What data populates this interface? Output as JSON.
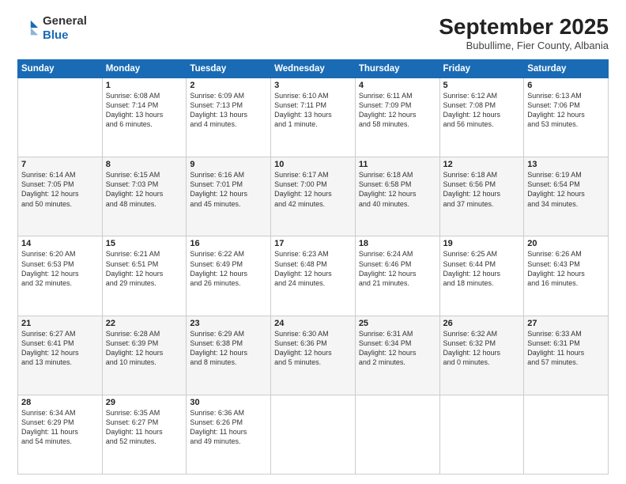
{
  "header": {
    "logo": {
      "line1": "General",
      "line2": "Blue"
    },
    "title": "September 2025",
    "location": "Bubullime, Fier County, Albania"
  },
  "weekdays": [
    "Sunday",
    "Monday",
    "Tuesday",
    "Wednesday",
    "Thursday",
    "Friday",
    "Saturday"
  ],
  "weeks": [
    [
      {
        "day": "",
        "info": ""
      },
      {
        "day": "1",
        "info": "Sunrise: 6:08 AM\nSunset: 7:14 PM\nDaylight: 13 hours\nand 6 minutes."
      },
      {
        "day": "2",
        "info": "Sunrise: 6:09 AM\nSunset: 7:13 PM\nDaylight: 13 hours\nand 4 minutes."
      },
      {
        "day": "3",
        "info": "Sunrise: 6:10 AM\nSunset: 7:11 PM\nDaylight: 13 hours\nand 1 minute."
      },
      {
        "day": "4",
        "info": "Sunrise: 6:11 AM\nSunset: 7:09 PM\nDaylight: 12 hours\nand 58 minutes."
      },
      {
        "day": "5",
        "info": "Sunrise: 6:12 AM\nSunset: 7:08 PM\nDaylight: 12 hours\nand 56 minutes."
      },
      {
        "day": "6",
        "info": "Sunrise: 6:13 AM\nSunset: 7:06 PM\nDaylight: 12 hours\nand 53 minutes."
      }
    ],
    [
      {
        "day": "7",
        "info": "Sunrise: 6:14 AM\nSunset: 7:05 PM\nDaylight: 12 hours\nand 50 minutes."
      },
      {
        "day": "8",
        "info": "Sunrise: 6:15 AM\nSunset: 7:03 PM\nDaylight: 12 hours\nand 48 minutes."
      },
      {
        "day": "9",
        "info": "Sunrise: 6:16 AM\nSunset: 7:01 PM\nDaylight: 12 hours\nand 45 minutes."
      },
      {
        "day": "10",
        "info": "Sunrise: 6:17 AM\nSunset: 7:00 PM\nDaylight: 12 hours\nand 42 minutes."
      },
      {
        "day": "11",
        "info": "Sunrise: 6:18 AM\nSunset: 6:58 PM\nDaylight: 12 hours\nand 40 minutes."
      },
      {
        "day": "12",
        "info": "Sunrise: 6:18 AM\nSunset: 6:56 PM\nDaylight: 12 hours\nand 37 minutes."
      },
      {
        "day": "13",
        "info": "Sunrise: 6:19 AM\nSunset: 6:54 PM\nDaylight: 12 hours\nand 34 minutes."
      }
    ],
    [
      {
        "day": "14",
        "info": "Sunrise: 6:20 AM\nSunset: 6:53 PM\nDaylight: 12 hours\nand 32 minutes."
      },
      {
        "day": "15",
        "info": "Sunrise: 6:21 AM\nSunset: 6:51 PM\nDaylight: 12 hours\nand 29 minutes."
      },
      {
        "day": "16",
        "info": "Sunrise: 6:22 AM\nSunset: 6:49 PM\nDaylight: 12 hours\nand 26 minutes."
      },
      {
        "day": "17",
        "info": "Sunrise: 6:23 AM\nSunset: 6:48 PM\nDaylight: 12 hours\nand 24 minutes."
      },
      {
        "day": "18",
        "info": "Sunrise: 6:24 AM\nSunset: 6:46 PM\nDaylight: 12 hours\nand 21 minutes."
      },
      {
        "day": "19",
        "info": "Sunrise: 6:25 AM\nSunset: 6:44 PM\nDaylight: 12 hours\nand 18 minutes."
      },
      {
        "day": "20",
        "info": "Sunrise: 6:26 AM\nSunset: 6:43 PM\nDaylight: 12 hours\nand 16 minutes."
      }
    ],
    [
      {
        "day": "21",
        "info": "Sunrise: 6:27 AM\nSunset: 6:41 PM\nDaylight: 12 hours\nand 13 minutes."
      },
      {
        "day": "22",
        "info": "Sunrise: 6:28 AM\nSunset: 6:39 PM\nDaylight: 12 hours\nand 10 minutes."
      },
      {
        "day": "23",
        "info": "Sunrise: 6:29 AM\nSunset: 6:38 PM\nDaylight: 12 hours\nand 8 minutes."
      },
      {
        "day": "24",
        "info": "Sunrise: 6:30 AM\nSunset: 6:36 PM\nDaylight: 12 hours\nand 5 minutes."
      },
      {
        "day": "25",
        "info": "Sunrise: 6:31 AM\nSunset: 6:34 PM\nDaylight: 12 hours\nand 2 minutes."
      },
      {
        "day": "26",
        "info": "Sunrise: 6:32 AM\nSunset: 6:32 PM\nDaylight: 12 hours\nand 0 minutes."
      },
      {
        "day": "27",
        "info": "Sunrise: 6:33 AM\nSunset: 6:31 PM\nDaylight: 11 hours\nand 57 minutes."
      }
    ],
    [
      {
        "day": "28",
        "info": "Sunrise: 6:34 AM\nSunset: 6:29 PM\nDaylight: 11 hours\nand 54 minutes."
      },
      {
        "day": "29",
        "info": "Sunrise: 6:35 AM\nSunset: 6:27 PM\nDaylight: 11 hours\nand 52 minutes."
      },
      {
        "day": "30",
        "info": "Sunrise: 6:36 AM\nSunset: 6:26 PM\nDaylight: 11 hours\nand 49 minutes."
      },
      {
        "day": "",
        "info": ""
      },
      {
        "day": "",
        "info": ""
      },
      {
        "day": "",
        "info": ""
      },
      {
        "day": "",
        "info": ""
      }
    ]
  ]
}
